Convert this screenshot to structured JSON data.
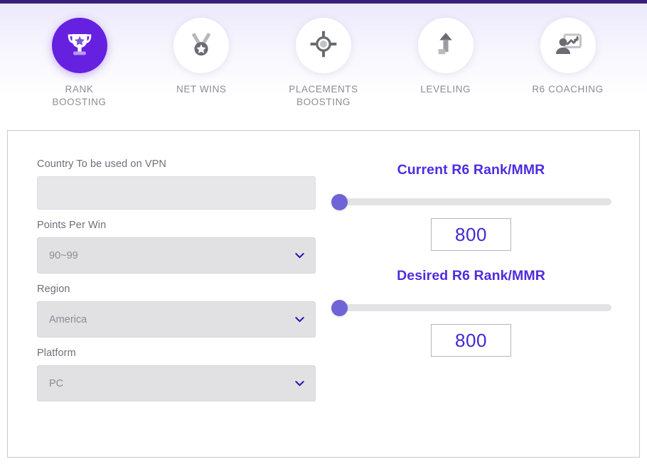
{
  "theme": {
    "accent_bar": "#3b2079",
    "active_tab_bg": "#6620e0",
    "slider_thumb": "#6f63d8",
    "slider_track": "#e3e3e5",
    "title_purple": "#4f2ce0",
    "value_purple": "#3f2ad2",
    "label_gray": "#6f6f7a",
    "field_bg": "#e1e1e4"
  },
  "tabs": [
    {
      "id": "rank-boosting",
      "label": "RANK\nBOOSTING",
      "icon": "trophy-icon",
      "active": true
    },
    {
      "id": "net-wins",
      "label": "NET WINS",
      "icon": "medal-icon",
      "active": false
    },
    {
      "id": "placements-boosting",
      "label": "PLACEMENTS\nBOOSTING",
      "icon": "target-icon",
      "active": false
    },
    {
      "id": "leveling",
      "label": "LEVELING",
      "icon": "level-up-icon",
      "active": false
    },
    {
      "id": "r6-coaching",
      "label": "R6 COACHING",
      "icon": "coaching-icon",
      "active": false
    }
  ],
  "form": {
    "country": {
      "label": "Country To be used on VPN",
      "value": "",
      "placeholder": ""
    },
    "points_per_win": {
      "label": "Points Per Win",
      "value": "90~99",
      "options": [
        "90~99"
      ],
      "chevron_icon": "chevron-down-icon"
    },
    "region": {
      "label": "Region",
      "value": "America",
      "options": [
        "America"
      ],
      "chevron_icon": "chevron-down-icon"
    },
    "platform": {
      "label": "Platform",
      "value": "PC",
      "options": [
        "PC"
      ],
      "chevron_icon": "chevron-down-icon"
    }
  },
  "sliders": {
    "current": {
      "title": "Current R6 Rank/MMR",
      "value": "800",
      "percent": 0
    },
    "desired": {
      "title": "Desired R6 Rank/MMR",
      "value": "800",
      "percent": 0
    }
  }
}
